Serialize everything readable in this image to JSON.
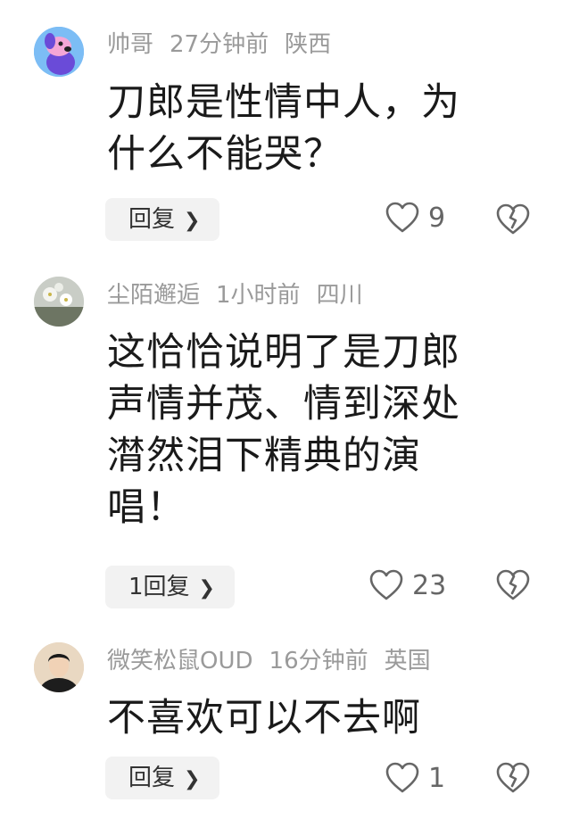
{
  "comments": [
    {
      "user": "帅哥",
      "time": "27分钟前",
      "location": "陕西",
      "text_lines": [
        "刀郎是性情中人，为",
        "什么不能哭？"
      ],
      "reply_label": "回复",
      "likes": "9"
    },
    {
      "user": "尘陌邂逅",
      "time": "1小时前",
      "location": "四川",
      "text_lines": [
        "这恰恰说明了是刀郎",
        "声情并茂、情到深处",
        "潸然泪下精典的演",
        "唱！"
      ],
      "reply_label": "1回复",
      "likes": "23"
    },
    {
      "user": "微笑松鼠OUD",
      "time": "16分钟前",
      "location": "英国",
      "text_lines": [
        "不喜欢可以不去啊"
      ],
      "reply_label": "回复",
      "likes": "1"
    }
  ],
  "icons": {
    "like": "heart-outline-icon",
    "dislike": "broken-heart-icon",
    "chevron": "chevron-right-icon"
  },
  "colors": {
    "meta_text": "#9a9a9a",
    "body_text": "#1a1a1a",
    "reply_bg": "#f2f2f2"
  }
}
